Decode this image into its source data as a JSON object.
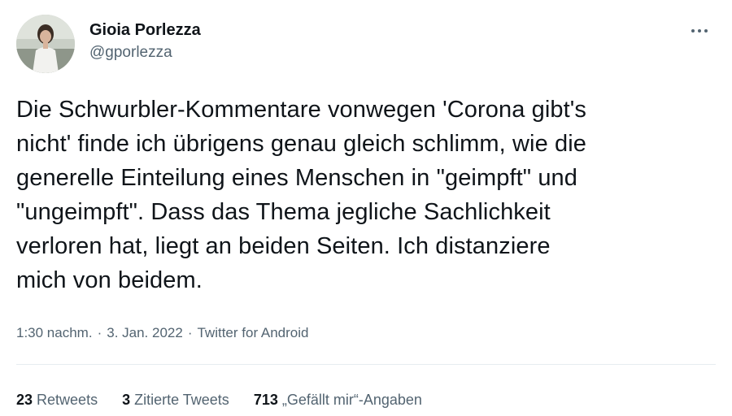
{
  "user": {
    "display_name": "Gioia Porlezza",
    "handle": "@gporlezza"
  },
  "icons": {
    "more": "more-horizontal-icon",
    "avatar": "profile-photo"
  },
  "tweet": {
    "text": "Die Schwurbler-Kommentare vonwegen 'Corona gibt's\nnicht' finde ich übrigens genau gleich schlimm, wie die\ngenerelle Einteilung eines Menschen in \"geimpft\" und\n\"ungeimpft\". Dass das Thema jegliche Sachlichkeit\nverloren hat, liegt an beiden Seiten. Ich distanziere\nmich von beidem.",
    "time": "1:30 nachm.",
    "separator": "·",
    "date": "3. Jan. 2022",
    "source": "Twitter for Android"
  },
  "stats": {
    "retweets_count": "23",
    "retweets_label": "Retweets",
    "quotes_count": "3",
    "quotes_label": "Zitierte Tweets",
    "likes_count": "713",
    "likes_label": "„Gefällt mir“-Angaben"
  },
  "colors": {
    "text_primary": "#0f1419",
    "text_secondary": "#536471",
    "divider": "#e6ecf0",
    "background": "#ffffff"
  }
}
